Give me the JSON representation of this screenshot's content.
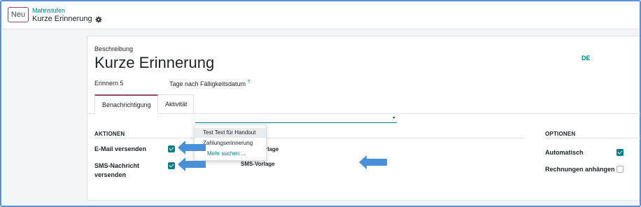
{
  "header": {
    "new_button": "Neu",
    "breadcrumb_parent": "Mahnstufen",
    "breadcrumb_current": "Kurze Erinnerung"
  },
  "form": {
    "description_label": "Beschreibung",
    "title": "Kurze Erinnerung",
    "language": "DE",
    "remind_text": "Erinnern 5",
    "days_text": "Tage nach Fälligkeitsdatum",
    "help_mark": "?"
  },
  "tabs": [
    {
      "label": "Benachrichtigung",
      "active": true
    },
    {
      "label": "Aktivität",
      "active": false
    }
  ],
  "actions": {
    "section_title": "AKTIONEN",
    "email_label": "E-Mail versenden",
    "email_checked": true,
    "sms_label_line1": "SMS-Nachricht",
    "sms_label_line2": "versenden",
    "sms_checked": true,
    "template_label": "Inhaltsvorlage",
    "template_value": "",
    "sms_template_label": "SMS-Vorlage"
  },
  "dropdown": {
    "options": [
      "Test Text für Handout",
      "Zahlungserinnerung"
    ],
    "more": "Mehr suchen ..."
  },
  "options": {
    "section_title": "OPTIONEN",
    "auto_label": "Automatisch",
    "auto_checked": true,
    "attach_label": "Rechnungen anhängen",
    "attach_checked": false
  },
  "colors": {
    "accent": "#017e84",
    "brand": "#8a4b6b",
    "annotation_arrow": "#4a90d9",
    "frame_border": "#5b8fd6"
  }
}
